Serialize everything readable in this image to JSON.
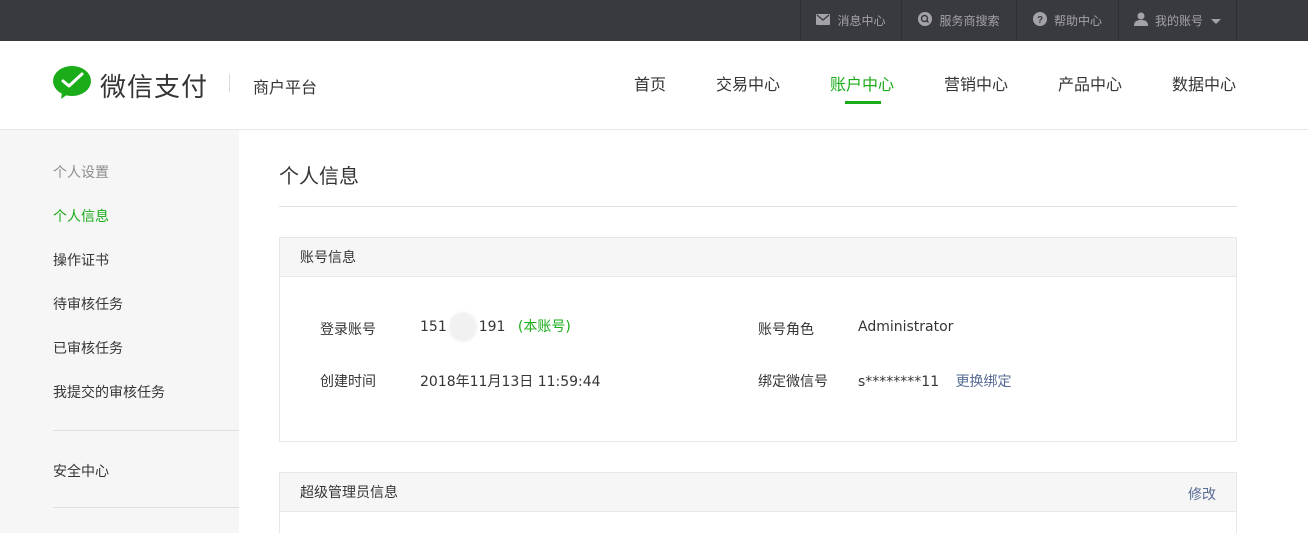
{
  "topbar": {
    "messages": "消息中心",
    "provider_search": "服务商搜索",
    "help": "帮助中心",
    "account": "我的账号"
  },
  "header": {
    "brand": "微信支付",
    "subtitle": "商户平台",
    "nav": [
      "首页",
      "交易中心",
      "账户中心",
      "营销中心",
      "产品中心",
      "数据中心"
    ],
    "active_nav": "账户中心"
  },
  "sidebar": {
    "group_title": "个人设置",
    "items": [
      "个人信息",
      "操作证书",
      "待审核任务",
      "已审核任务",
      "我提交的审核任务"
    ],
    "security": "安全中心"
  },
  "main": {
    "title": "个人信息",
    "account_panel": {
      "title": "账号信息",
      "login_label": "登录账号",
      "login_prefix": "151",
      "login_suffix": "191",
      "login_tag": "(本账号)",
      "role_label": "账号角色",
      "role_value": "Administrator",
      "created_label": "创建时间",
      "created_value": "2018年11月13日 11:59:44",
      "wechat_label": "绑定微信号",
      "wechat_value": "s********11",
      "rebind": "更换绑定"
    },
    "admin_panel": {
      "title": "超级管理员信息",
      "edit": "修改"
    }
  },
  "colors": {
    "accent": "#1aad19",
    "link": "#576b95",
    "topbar": "#393a3f"
  }
}
